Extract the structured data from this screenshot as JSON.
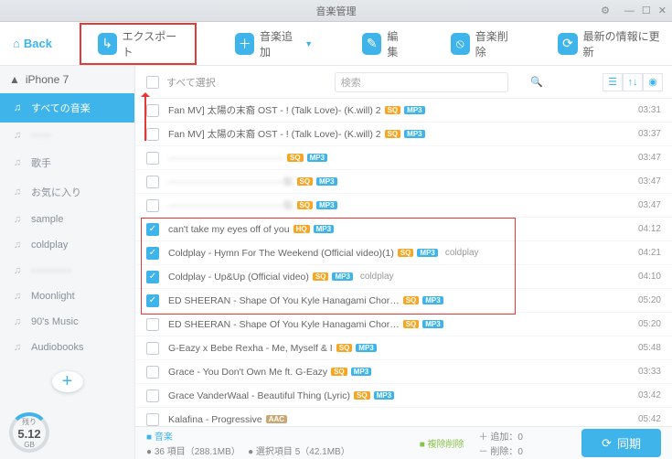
{
  "window": {
    "title": "音楽管理"
  },
  "back": "Back",
  "toolbar": {
    "export": "エクスポート",
    "add": "音楽追加",
    "edit": "編集",
    "delete": "音楽削除",
    "refresh": "最新の情報に更新"
  },
  "sidebar": {
    "device": "iPhone 7",
    "items": [
      {
        "label": "すべての音楽"
      },
      {
        "label": "——"
      },
      {
        "label": "歌手"
      },
      {
        "label": "お気に入り"
      },
      {
        "label": "sample"
      },
      {
        "label": "coldplay"
      },
      {
        "label": "————"
      },
      {
        "label": "Moonlight"
      },
      {
        "label": "90's Music"
      },
      {
        "label": "Audiobooks"
      }
    ]
  },
  "storage": {
    "label": "残り",
    "value": "5.12",
    "unit": "GB"
  },
  "listHeader": {
    "selectAll": "すべて選択",
    "search": "検索"
  },
  "rows": [
    {
      "chk": false,
      "title": "Fan MV]  太陽の末裔 OST - ! (Talk Love)- (K.will) 2",
      "b1": "SQ",
      "b2": "MP3",
      "artist": "",
      "dur": "03:31"
    },
    {
      "chk": false,
      "title": "Fan MV]  太陽の末裔 OST - ! (Talk Love)- (K.will) 2",
      "b1": "SQ",
      "b2": "MP3",
      "artist": "",
      "dur": "03:37"
    },
    {
      "chk": false,
      "title": "————————————",
      "b1": "SQ",
      "b2": "MP3",
      "artist": "",
      "dur": "03:47",
      "blur": true
    },
    {
      "chk": false,
      "title": "————————————梨",
      "b1": "SQ",
      "b2": "MP3",
      "artist": "",
      "dur": "03:47",
      "blur": true
    },
    {
      "chk": false,
      "title": "————————————梨",
      "b1": "SQ",
      "b2": "MP3",
      "artist": "",
      "dur": "03:47",
      "blur": true
    },
    {
      "chk": true,
      "title": "can't take my eyes off of you",
      "b1": "HQ",
      "b2": "MP3",
      "artist": "",
      "dur": "04:12"
    },
    {
      "chk": true,
      "title": "Coldplay - Hymn For The Weekend (Official video)(1)",
      "b1": "SQ",
      "b2": "MP3",
      "artist": "coldplay",
      "dur": "04:21"
    },
    {
      "chk": true,
      "title": "Coldplay - Up&Up (Official video)",
      "b1": "SQ",
      "b2": "MP3",
      "artist": "coldplay",
      "dur": "04:10"
    },
    {
      "chk": true,
      "title": "ED SHEERAN - Shape Of You   Kyle Hanagami Chor…",
      "b1": "SQ",
      "b2": "MP3",
      "artist": "",
      "dur": "05:20"
    },
    {
      "chk": false,
      "title": "ED SHEERAN - Shape Of You   Kyle Hanagami Chor…",
      "b1": "SQ",
      "b2": "MP3",
      "artist": "",
      "dur": "05:20"
    },
    {
      "chk": false,
      "title": "G-Eazy x Bebe Rexha - Me, Myself & I",
      "b1": "SQ",
      "b2": "MP3",
      "artist": "",
      "dur": "05:48"
    },
    {
      "chk": false,
      "title": "Grace - You Don't Own Me ft. G-Eazy",
      "b1": "SQ",
      "b2": "MP3",
      "artist": "",
      "dur": "03:33"
    },
    {
      "chk": false,
      "title": "Grace VanderWaal - Beautiful Thing (Lyric)",
      "b1": "SQ",
      "b2": "MP3",
      "artist": "",
      "dur": "03:42"
    },
    {
      "chk": false,
      "title": "Kalafina - Progressive",
      "b1": "AAC",
      "b2": "",
      "artist": "",
      "dur": "05:42"
    }
  ],
  "footer": {
    "musicLabel": "音楽",
    "musicDetail": "36 項目（288.1MB）",
    "selectedDetail": "選択項目 5（42.1MB）",
    "dupLabel": "複除削除",
    "addLabel": "追加：",
    "addVal": "0",
    "delLabel": "削除：",
    "delVal": "0",
    "sync": "同期"
  }
}
